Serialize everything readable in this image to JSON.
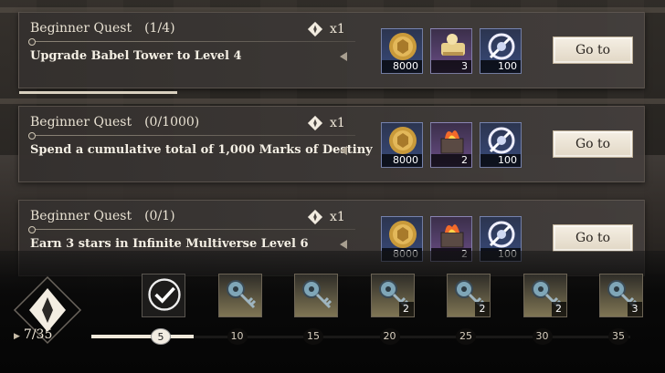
{
  "quests": [
    {
      "title": "Beginner Quest",
      "progress": "(1/4)",
      "description": "Upgrade Babel Tower to Level 4",
      "points": "x1",
      "rewards": [
        {
          "icon": "gold-coin-icon",
          "qty": "8000",
          "tier": "blue"
        },
        {
          "icon": "golden-scroll-icon",
          "qty": "3",
          "tier": "purple"
        },
        {
          "icon": "tower-point-icon",
          "qty": "100",
          "tier": "blue"
        }
      ],
      "button": "Go to"
    },
    {
      "title": "Beginner Quest",
      "progress": "(0/1000)",
      "description": "Spend a cumulative total of 1,000 Marks of Destiny",
      "points": "x1",
      "rewards": [
        {
          "icon": "gold-coin-icon",
          "qty": "8000",
          "tier": "blue"
        },
        {
          "icon": "flame-chest-icon",
          "qty": "2",
          "tier": "purple"
        },
        {
          "icon": "tower-point-icon",
          "qty": "100",
          "tier": "blue"
        }
      ],
      "button": "Go to"
    },
    {
      "title": "Beginner Quest",
      "progress": "(0/1)",
      "description": "Earn 3 stars in Infinite Multiverse Level 6",
      "points": "x1",
      "rewards": [
        {
          "icon": "gold-coin-icon",
          "qty": "8000",
          "tier": "blue"
        },
        {
          "icon": "flame-chest-icon",
          "qty": "2",
          "tier": "purple"
        },
        {
          "icon": "tower-point-icon",
          "qty": "100",
          "tier": "blue"
        }
      ],
      "button": "Go to"
    }
  ],
  "quest_progress_fraction": 0.25,
  "activity_points": "7/35",
  "activity_fraction": 0.2,
  "milestones": [
    {
      "value": "5",
      "reward": "check-claimed-icon",
      "qty": "",
      "claimed": true
    },
    {
      "value": "10",
      "reward": "key-icon",
      "qty": "",
      "claimed": false
    },
    {
      "value": "15",
      "reward": "key-icon",
      "qty": "",
      "claimed": false
    },
    {
      "value": "20",
      "reward": "key-icon",
      "qty": "2",
      "claimed": false
    },
    {
      "value": "25",
      "reward": "key-icon",
      "qty": "2",
      "claimed": false
    },
    {
      "value": "30",
      "reward": "key-icon",
      "qty": "2",
      "claimed": false
    },
    {
      "value": "35",
      "reward": "key-icon",
      "qty": "3",
      "claimed": false
    }
  ],
  "colors": {
    "card_bg": "#3a3634",
    "button_bg": "#f0e9dc",
    "reward_blue": "#384a7a",
    "reward_purple": "#6a4d86"
  }
}
